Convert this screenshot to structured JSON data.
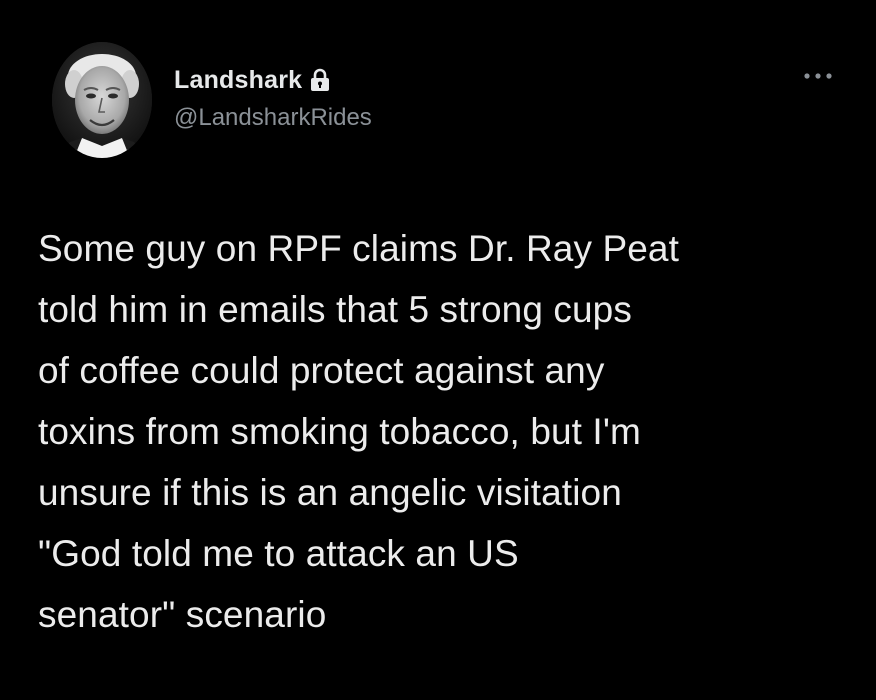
{
  "colors": {
    "background": "#000000",
    "primary_text": "#e7e9ea",
    "secondary_text": "#8b9197"
  },
  "author": {
    "display_name": "Landshark",
    "handle": "@LandsharkRides",
    "lock_icon": "lock-icon",
    "avatar": "avatar-photo"
  },
  "menu": {
    "icon": "more-options-icon"
  },
  "tweet": {
    "text": "Some guy on RPF claims Dr. Ray Peat\ntold him in emails that 5 strong cups\nof coffee could protect against any\ntoxins from smoking tobacco, but I'm\nunsure if this is an angelic visitation\n\"God told me to attack an US\nsenator\" scenario"
  }
}
